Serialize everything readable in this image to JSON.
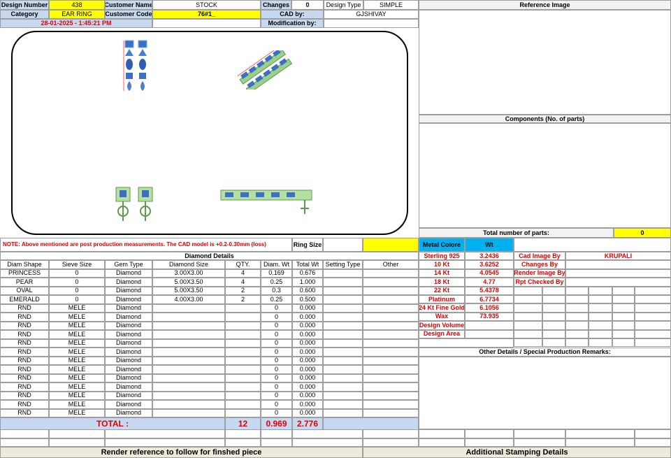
{
  "header": {
    "design_number_label": "Design Number",
    "design_number": "438",
    "customer_name_label": "Customer Name",
    "customer_name": "STOCK",
    "changes_label": "Changes",
    "changes": "0",
    "design_type_label": "Design Type",
    "design_type": "SIMPLE",
    "category_label": "Category",
    "category": "EAR RING",
    "customer_code_label": "Customer Code",
    "customer_code": "76#1_",
    "cad_by_label": "CAD by:",
    "cad_by": "GJSHIVAY",
    "timestamp": "28-01-2025 - 1:45:21 PM",
    "modification_by_label": "Modification by:",
    "modification_by": ""
  },
  "right_panel": {
    "reference_image_label": "Reference Image",
    "components_label": "Components (No. of parts)",
    "total_parts_label": "Total number of parts:",
    "total_parts": "0"
  },
  "note": "NOTE: Above mentioned are post production measurements. The CAD model is +0.2-0.30mm (loss)",
  "ring_size_label": "Ring Size",
  "diamond_details_label": "Diamond Details",
  "table": {
    "headers": [
      "Diam Shape",
      "Sieve Size",
      "Gem Type",
      "Diamond Size",
      "QTY.",
      "Diam. Wt",
      "Total Wt",
      "Setting Type",
      "Other"
    ],
    "rows": [
      [
        "PRINCESS",
        "0",
        "Diamond",
        "3.00X3.00",
        "4",
        "0.169",
        "0.676",
        "",
        ""
      ],
      [
        "PEAR",
        "0",
        "Diamond",
        "5.00X3.50",
        "4",
        "0.25",
        "1.000",
        "",
        ""
      ],
      [
        "OVAL",
        "0",
        "Diamond",
        "5.00X3.50",
        "2",
        "0.3",
        "0.600",
        "",
        ""
      ],
      [
        "EMERALD",
        "0",
        "Diamond",
        "4.00X3.00",
        "2",
        "0.25",
        "0.500",
        "",
        ""
      ],
      [
        "RND",
        "MELE",
        "Diamond",
        "",
        "",
        "0",
        "0.000",
        "",
        ""
      ],
      [
        "RND",
        "MELE",
        "Diamond",
        "",
        "",
        "0",
        "0.000",
        "",
        ""
      ],
      [
        "RND",
        "MELE",
        "Diamond",
        "",
        "",
        "0",
        "0.000",
        "",
        ""
      ],
      [
        "RND",
        "MELE",
        "Diamond",
        "",
        "",
        "0",
        "0.000",
        "",
        ""
      ],
      [
        "RND",
        "MELE",
        "Diamond",
        "",
        "",
        "0",
        "0.000",
        "",
        ""
      ],
      [
        "RND",
        "MELE",
        "Diamond",
        "",
        "",
        "0",
        "0.000",
        "",
        ""
      ],
      [
        "RND",
        "MELE",
        "Diamond",
        "",
        "",
        "0",
        "0.000",
        "",
        ""
      ],
      [
        "RND",
        "MELE",
        "Diamond",
        "",
        "",
        "0",
        "0.000",
        "",
        ""
      ],
      [
        "RND",
        "MELE",
        "Diamond",
        "",
        "",
        "0",
        "0.000",
        "",
        ""
      ],
      [
        "RND",
        "MELE",
        "Diamond",
        "",
        "",
        "0",
        "0.000",
        "",
        ""
      ],
      [
        "RND",
        "MELE",
        "Diamond",
        "",
        "",
        "0",
        "0.000",
        "",
        ""
      ],
      [
        "RND",
        "MELE",
        "Diamond",
        "",
        "",
        "0",
        "0.000",
        "",
        ""
      ],
      [
        "RND",
        "MELE",
        "Diamond",
        "",
        "",
        "0",
        "0.000",
        "",
        ""
      ]
    ],
    "total_label": "TOTAL :",
    "total_qty": "12",
    "total_diam_wt": "0.969",
    "total_wt": "2.776"
  },
  "metal": {
    "color_label": "Metal Colore",
    "wt_label": "Wt",
    "rows": [
      [
        "Sterling 925",
        "3.2436"
      ],
      [
        "10 Kt",
        "3.6252"
      ],
      [
        "14 Kt",
        "4.0545"
      ],
      [
        "18 Kt",
        "4.77"
      ],
      [
        "22 Kt",
        "5.4378"
      ],
      [
        "Platinum",
        "6.7734"
      ],
      [
        "24 Kt Fine Gold",
        "6.1056"
      ],
      [
        "Wax",
        "73.935"
      ],
      [
        "Design Volume",
        ""
      ],
      [
        "Design Area",
        ""
      ]
    ]
  },
  "credits": {
    "rows": [
      [
        "Cad Image By",
        "KRUPALI"
      ],
      [
        "Changes By",
        ""
      ],
      [
        "Render Image By",
        ""
      ],
      [
        "Rpt Checked By",
        ""
      ]
    ]
  },
  "other_details_label": "Other Details / Special Production Remarks:",
  "footer": {
    "render_reference": "Render reference to follow for finshed piece",
    "stamping": "Additional Stamping Details"
  },
  "colors": {
    "yellow": "#ffff00",
    "blue_header": "#c6d9f1",
    "red_text": "#e00000",
    "cyan": "#00b0f0"
  }
}
